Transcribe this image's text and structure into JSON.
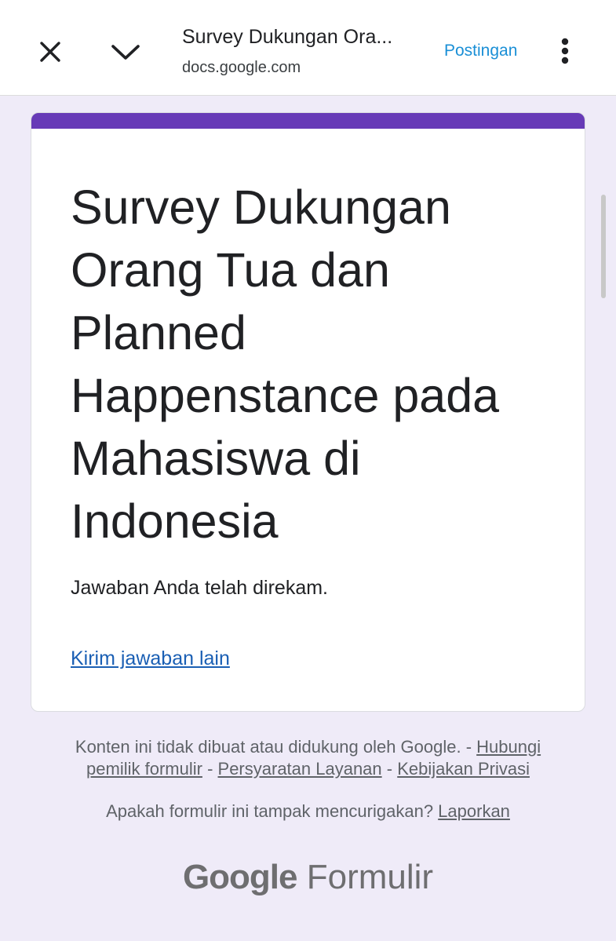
{
  "browser": {
    "page_title": "Survey Dukungan Ora...",
    "url": "docs.google.com",
    "post_label": "Postingan",
    "icons": [
      "close-icon",
      "chevron-down-icon",
      "more-vert-icon"
    ]
  },
  "form": {
    "accent_color": "#673ab7",
    "title": "Survey Dukungan Orang Tua dan Planned Happenstance pada Mahasiswa di Indonesia",
    "confirmation": "Jawaban Anda telah direkam.",
    "resubmit_link": "Kirim jawaban lain"
  },
  "footer": {
    "disclaimer_text": "Konten ini tidak dibuat atau didukung oleh Google. - ",
    "contact_owner": "Hubungi pemilik formulir",
    "sep1": " - ",
    "terms": "Persyaratan Layanan",
    "sep2": " - ",
    "privacy": "Kebijakan Privasi",
    "report_question": "Apakah formulir ini tampak mencurigakan? ",
    "report_link": "Laporkan",
    "brand_google": "Google",
    "brand_forms": "Formulir"
  }
}
